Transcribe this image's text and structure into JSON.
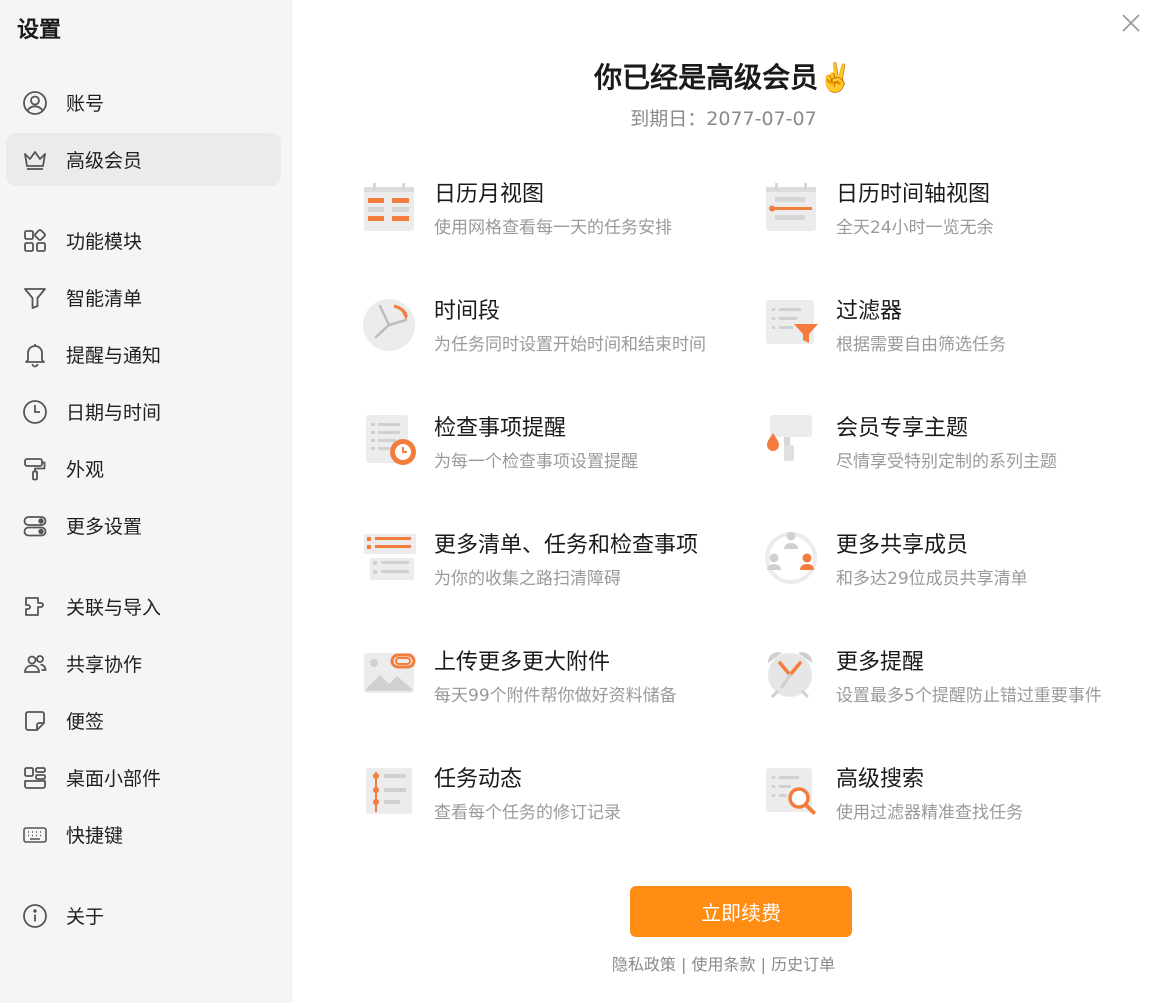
{
  "sidebar": {
    "title": "设置",
    "items": [
      {
        "label": "账号",
        "icon": "user-icon"
      },
      {
        "label": "高级会员",
        "icon": "crown-icon"
      },
      {
        "label": "功能模块",
        "icon": "modules-icon"
      },
      {
        "label": "智能清单",
        "icon": "filter-icon"
      },
      {
        "label": "提醒与通知",
        "icon": "bell-icon"
      },
      {
        "label": "日期与时间",
        "icon": "clock-icon"
      },
      {
        "label": "外观",
        "icon": "paint-roller-icon"
      },
      {
        "label": "更多设置",
        "icon": "toggles-icon"
      },
      {
        "label": "关联与导入",
        "icon": "import-icon"
      },
      {
        "label": "共享协作",
        "icon": "people-icon"
      },
      {
        "label": "便签",
        "icon": "sticky-note-icon"
      },
      {
        "label": "桌面小部件",
        "icon": "widget-icon"
      },
      {
        "label": "快捷键",
        "icon": "keyboard-icon"
      },
      {
        "label": "关于",
        "icon": "info-icon"
      }
    ]
  },
  "main": {
    "title": "你已经是高级会员✌️",
    "expiry": "到期日：2077-07-07",
    "features": [
      {
        "title": "日历月视图",
        "desc": "使用网格查看每一天的任务安排",
        "icon": "calendar-month-icon"
      },
      {
        "title": "日历时间轴视图",
        "desc": "全天24小时一览无余",
        "icon": "calendar-timeline-icon"
      },
      {
        "title": "时间段",
        "desc": "为任务同时设置开始时间和结束时间",
        "icon": "time-range-icon"
      },
      {
        "title": "过滤器",
        "desc": "根据需要自由筛选任务",
        "icon": "filter-list-icon"
      },
      {
        "title": "检查事项提醒",
        "desc": "为每一个检查事项设置提醒",
        "icon": "checklist-reminder-icon"
      },
      {
        "title": "会员专享主题",
        "desc": "尽情享受特别定制的系列主题",
        "icon": "theme-icon"
      },
      {
        "title": "更多清单、任务和检查事项",
        "desc": "为你的收集之路扫清障碍",
        "icon": "more-lists-icon"
      },
      {
        "title": "更多共享成员",
        "desc": "和多达29位成员共享清单",
        "icon": "share-members-icon"
      },
      {
        "title": "上传更多更大附件",
        "desc": "每天99个附件帮你做好资料储备",
        "icon": "attachment-icon"
      },
      {
        "title": "更多提醒",
        "desc": "设置最多5个提醒防止错过重要事件",
        "icon": "alarm-clock-icon"
      },
      {
        "title": "任务动态",
        "desc": "查看每个任务的修订记录",
        "icon": "task-activity-icon"
      },
      {
        "title": "高级搜索",
        "desc": "使用过滤器精准查找任务",
        "icon": "advanced-search-icon"
      }
    ],
    "renew_button": "立即续费",
    "footer": {
      "privacy": "隐私政策",
      "terms": "使用条款",
      "orders": "历史订单",
      "separator": " | "
    }
  },
  "colors": {
    "accent": "#ff8d14",
    "icon_orange": "#f47c3c",
    "icon_gray": "#e6e6e6"
  }
}
